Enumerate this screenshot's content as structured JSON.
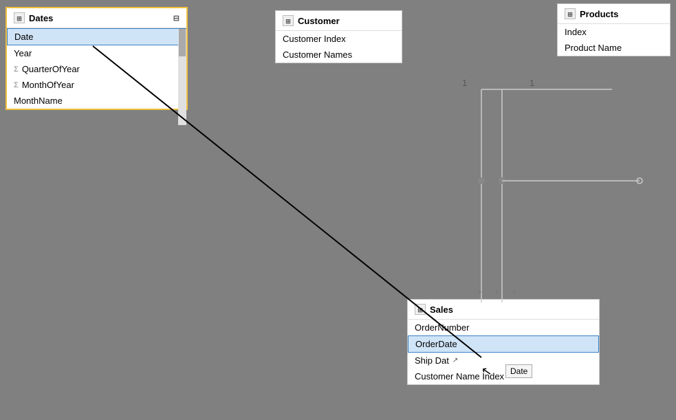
{
  "dates": {
    "title": "Dates",
    "fields": [
      {
        "name": "Date",
        "type": "plain",
        "highlighted": true
      },
      {
        "name": "Year",
        "type": "plain"
      },
      {
        "name": "QuarterOfYear",
        "type": "sigma"
      },
      {
        "name": "MonthOfYear",
        "type": "sigma"
      },
      {
        "name": "MonthName",
        "type": "plain"
      }
    ]
  },
  "customer": {
    "title": "Customer",
    "fields": [
      {
        "name": "Customer Index",
        "type": "plain"
      },
      {
        "name": "Customer Names",
        "type": "plain"
      }
    ]
  },
  "products": {
    "title": "Products",
    "fields": [
      {
        "name": "Index",
        "type": "plain"
      },
      {
        "name": "Product Name",
        "type": "plain"
      }
    ]
  },
  "sales": {
    "title": "Sales",
    "fields": [
      {
        "name": "OrderNumber",
        "type": "plain"
      },
      {
        "name": "OrderDate",
        "type": "plain",
        "highlighted": true
      },
      {
        "name": "Ship Date",
        "type": "plain"
      },
      {
        "name": "Customer Name Index",
        "type": "plain"
      }
    ]
  },
  "tooltip": {
    "text": "Date"
  },
  "relation_labels": {
    "one_left": "1",
    "one_right": "1",
    "many_left": "*",
    "many_center": "*",
    "many_right": "*"
  }
}
